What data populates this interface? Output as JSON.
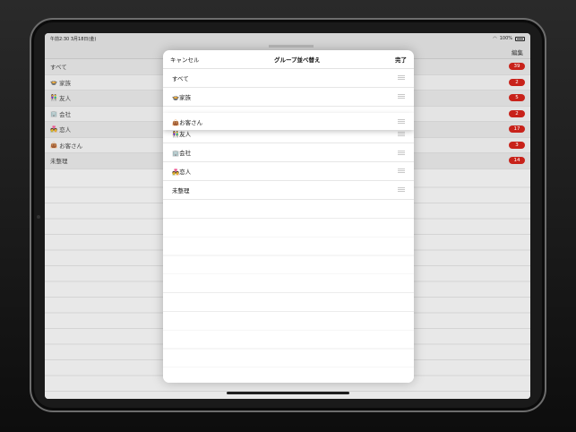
{
  "status": {
    "time": "午前2:30",
    "date": "3月18日(金)",
    "battery": "100%"
  },
  "nav": {
    "edit_label": "編集"
  },
  "groups": [
    {
      "emoji": "",
      "name": "すべて",
      "count": "39"
    },
    {
      "emoji": "🍲",
      "name": "家族",
      "count": "2"
    },
    {
      "emoji": "👫",
      "name": "友人",
      "count": "5"
    },
    {
      "emoji": "🏢",
      "name": "会社",
      "count": "2"
    },
    {
      "emoji": "💑",
      "name": "恋人",
      "count": "17"
    },
    {
      "emoji": "👜",
      "name": "お客さん",
      "count": "3"
    },
    {
      "emoji": "",
      "name": "未整理",
      "count": "14"
    }
  ],
  "modal": {
    "cancel": "キャンセル",
    "title": "グループ並べ替え",
    "done": "完了",
    "rows": [
      {
        "emoji": "",
        "name": "すべて"
      },
      {
        "emoji": "🍲",
        "name": "家族"
      },
      {
        "emoji": "👫",
        "name": "友人"
      },
      {
        "emoji": "🏢",
        "name": "会社"
      },
      {
        "emoji": "💑",
        "name": "恋人"
      },
      {
        "emoji": "",
        "name": "未整理"
      }
    ],
    "dragging": {
      "emoji": "👜",
      "name": "お客さん"
    }
  },
  "colors": {
    "badge": "#c8221a"
  }
}
